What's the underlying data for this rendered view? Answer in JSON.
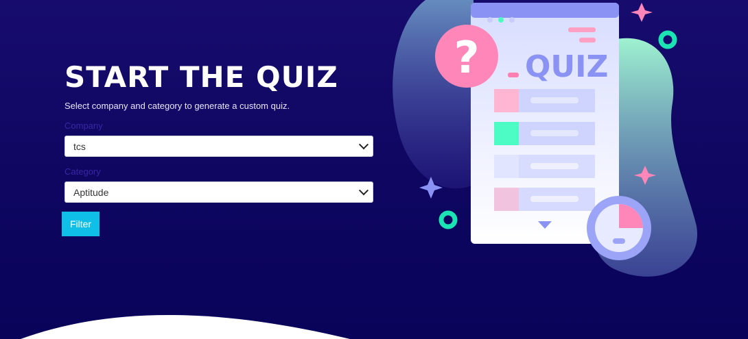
{
  "hero": {
    "title": "START THE QUIZ",
    "subtitle": "Select company and category to generate a custom quiz."
  },
  "form": {
    "company": {
      "label": "Company",
      "selected": "tcs"
    },
    "category": {
      "label": "Category",
      "selected": "Aptitude"
    },
    "filter_label": "Filter"
  },
  "illustration": {
    "word": "QUIZ",
    "question_mark": "?",
    "icons": [
      "question-mark-icon",
      "clock-icon",
      "sparkle-icon",
      "ring-icon"
    ]
  },
  "colors": {
    "background": "#140b6b",
    "accent": "#10bfe8",
    "pink": "#ff7fb0",
    "mint": "#4dfbc4",
    "lavender": "#8a93f3"
  }
}
